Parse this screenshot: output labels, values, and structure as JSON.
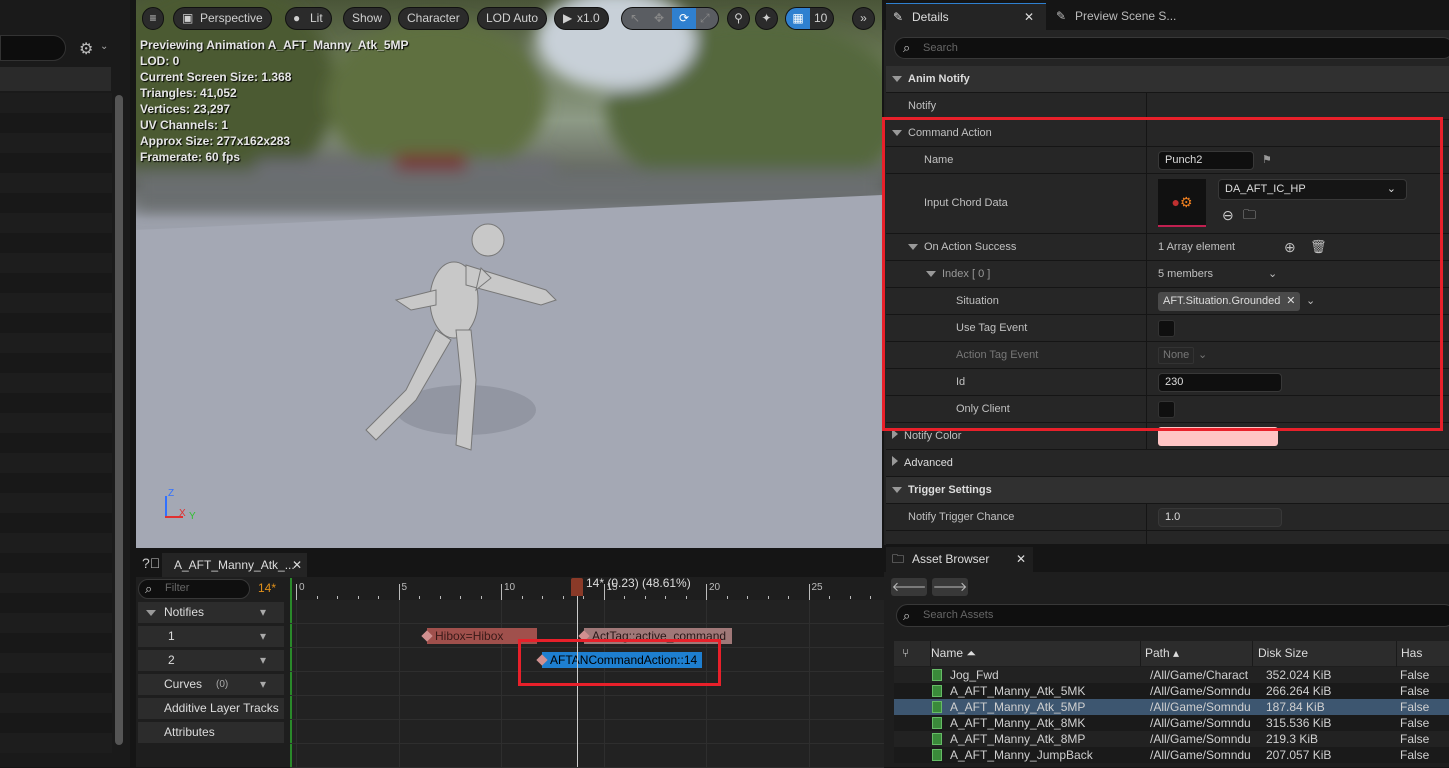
{
  "left_panel": {
    "settings_icon": "gear-icon"
  },
  "viewport": {
    "toolbar": {
      "menu": "hamburger-icon",
      "perspective": "Perspective",
      "lit": "Lit",
      "show": "Show",
      "character": "Character",
      "lod": "LOD Auto",
      "speed": "x1.0",
      "grid_value": "10"
    },
    "stats": [
      "Previewing Animation A_AFT_Manny_Atk_5MP",
      "LOD: 0",
      "Current Screen Size: 1.368",
      "Triangles: 41,052",
      "Vertices: 23,297",
      "UV Channels: 1",
      "Approx Size: 277x162x283",
      "Framerate: 60 fps"
    ],
    "axis": {
      "z": "Z",
      "x": "X",
      "y": "Y"
    }
  },
  "details": {
    "tabs": [
      {
        "label": "Details"
      },
      {
        "label": "Preview Scene S..."
      }
    ],
    "search_placeholder": "Search",
    "rows": {
      "anim_notify": "Anim Notify",
      "notify": "Notify",
      "command_action": "Command Action",
      "name": "Name",
      "name_value": "Punch2",
      "input_chord": "Input Chord Data",
      "input_chord_value": "DA_AFT_IC_HP",
      "on_action_success": "On Action Success",
      "on_action_success_value": "1 Array element",
      "index": "Index [ 0 ]",
      "index_value": "5 members",
      "situation": "Situation",
      "situation_value": "AFT.Situation.Grounded",
      "use_tag_event": "Use Tag Event",
      "use_tag_event_checked": false,
      "action_tag_event": "Action Tag Event",
      "action_tag_event_value": "None",
      "id": "Id",
      "id_value": "230",
      "only_client": "Only Client",
      "only_client_checked": false,
      "notify_color": "Notify Color",
      "notify_color_value": "#ffc4c4",
      "advanced": "Advanced",
      "trigger_settings": "Trigger Settings",
      "notify_trigger_chance": "Notify Trigger Chance",
      "notify_trigger_chance_value": "1.0"
    }
  },
  "timeline": {
    "tab": "A_AFT_Manny_Atk_...",
    "filter_placeholder": "Filter",
    "frame": "14*",
    "playhead_label": "14* (0.23) (48.61%)",
    "ticks": [
      "0",
      "5",
      "10",
      "15",
      "20",
      "25"
    ],
    "tracks": [
      {
        "label": "Notifies"
      },
      {
        "label": "1"
      },
      {
        "label": "2"
      },
      {
        "label": "Curves",
        "count": "(0)"
      },
      {
        "label": "Additive Layer Tracks"
      },
      {
        "label": "Attributes"
      }
    ],
    "notifies": [
      {
        "label": "Hibox=Hibox",
        "color": "#a0504c"
      },
      {
        "label": "ActTag::active_command",
        "color": "#a07878"
      },
      {
        "label": "AFTANCommandAction::14",
        "color": "#1e7fd0"
      }
    ]
  },
  "asset_browser": {
    "tab": "Asset Browser",
    "search_placeholder": "Search Assets",
    "columns": [
      "Name",
      "Path",
      "Disk Size",
      "Has Virtu"
    ],
    "rows": [
      [
        "Jog_Fwd",
        "/All/Game/Charact",
        "352.024 KiB",
        "False"
      ],
      [
        "A_AFT_Manny_Atk_5MK",
        "/All/Game/Somndu",
        "266.264 KiB",
        "False"
      ],
      [
        "A_AFT_Manny_Atk_5MP",
        "/All/Game/Somndu",
        "187.84 KiB",
        "False"
      ],
      [
        "A_AFT_Manny_Atk_8MK",
        "/All/Game/Somndu",
        "315.536 KiB",
        "False"
      ],
      [
        "A_AFT_Manny_Atk_8MP",
        "/All/Game/Somndu",
        "219.3 KiB",
        "False"
      ],
      [
        "A_AFT_Manny_JumpBack",
        "/All/Game/Somndu",
        "207.057 KiB",
        "False"
      ]
    ],
    "selected_row": 2
  },
  "colors": {
    "highlight": "#e8202a",
    "accent": "#1e7fd0"
  }
}
